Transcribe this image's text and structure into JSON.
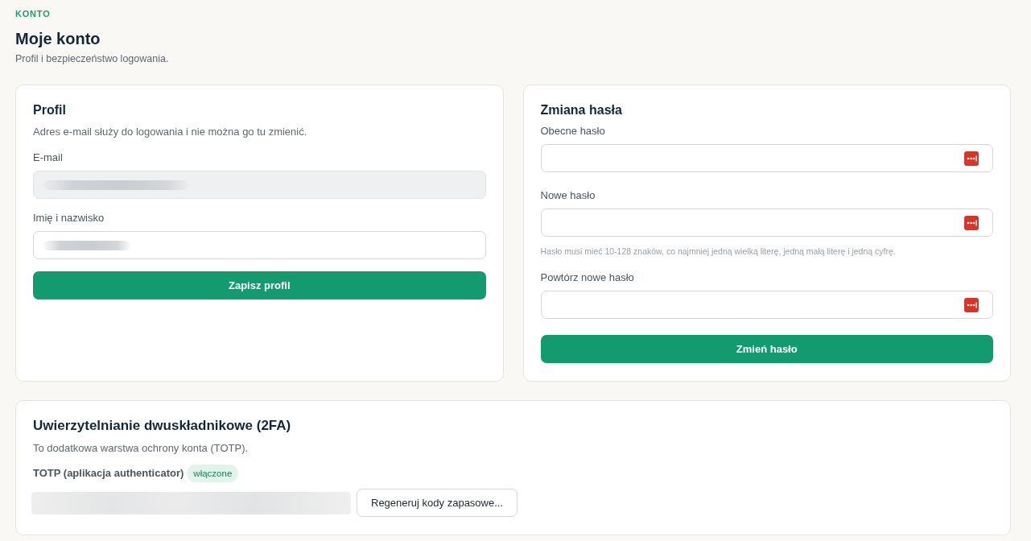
{
  "header": {
    "eyebrow": "KONTO",
    "title": "Moje konto",
    "subtitle": "Profil i bezpieczeństwo logowania."
  },
  "profile_card": {
    "title": "Profil",
    "description": "Adres e-mail służy do logowania i nie można go tu zmienić.",
    "fields": [
      {
        "label": "E-mail",
        "disabled": true,
        "redacted": true
      },
      {
        "label": "Imię i nazwisko",
        "disabled": false,
        "redacted": true
      }
    ],
    "button": "Zapisz profil"
  },
  "password_card": {
    "title": "Zmiana hasła",
    "fields": [
      {
        "label": "Obecne hasło"
      },
      {
        "label": "Nowe hasło",
        "hint": "Hasło musi mieć 10-128 znaków, co najmniej jedną wielką literę, jedną małą literę i jedną cyfrę."
      },
      {
        "label": "Powtórz nowe hasło"
      }
    ],
    "button": "Zmień hasło"
  },
  "twofa_card": {
    "title": "Uwierzytelnianie dwuskładnikowe (2FA)",
    "description": "To dodatkowa warstwa ochrony konta (TOTP).",
    "method": {
      "label": "TOTP (aplikacja authenticator)",
      "status": "włączone",
      "enabled": true
    },
    "codes_redacted": true,
    "button": "Regeneruj kody zapasowe..."
  }
}
